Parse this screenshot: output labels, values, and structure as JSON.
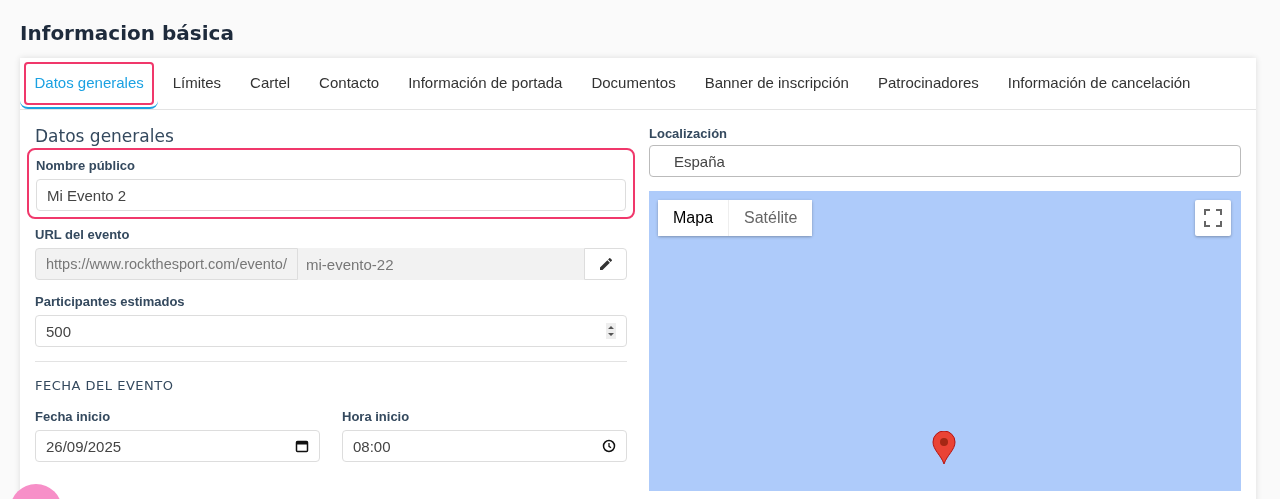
{
  "page_title": "Informacion básica",
  "tabs": [
    {
      "label": "Datos generales",
      "selected": true,
      "highlighted": true
    },
    {
      "label": "Límites",
      "selected": false,
      "highlighted": false
    },
    {
      "label": "Cartel",
      "selected": false,
      "highlighted": false
    },
    {
      "label": "Contacto",
      "selected": false,
      "highlighted": false
    },
    {
      "label": "Información de portada",
      "selected": false,
      "highlighted": false
    },
    {
      "label": "Documentos",
      "selected": false,
      "highlighted": false
    },
    {
      "label": "Banner de inscripción",
      "selected": false,
      "highlighted": false
    },
    {
      "label": "Patrocinadores",
      "selected": false,
      "highlighted": false
    },
    {
      "label": "Información de cancelación",
      "selected": false,
      "highlighted": false
    }
  ],
  "section_title": "Datos generales",
  "public_name": {
    "label": "Nombre público",
    "value": "Mi Evento 2",
    "highlighted": true
  },
  "event_url": {
    "label": "URL del evento",
    "prefix": "https://www.rockthesport.com/evento/",
    "slug": "mi-evento-22"
  },
  "participants": {
    "label": "Participantes estimados",
    "value": "500"
  },
  "date_section": "FECHA DEL EVENTO",
  "start_date": {
    "label": "Fecha inicio",
    "value": "26/09/2025"
  },
  "start_time": {
    "label": "Hora inicio",
    "value": "08:00"
  },
  "location": {
    "label": "Localización",
    "value": "España"
  },
  "map": {
    "types": [
      {
        "label": "Mapa",
        "selected": true
      },
      {
        "label": "Satélite",
        "selected": false
      }
    ]
  }
}
